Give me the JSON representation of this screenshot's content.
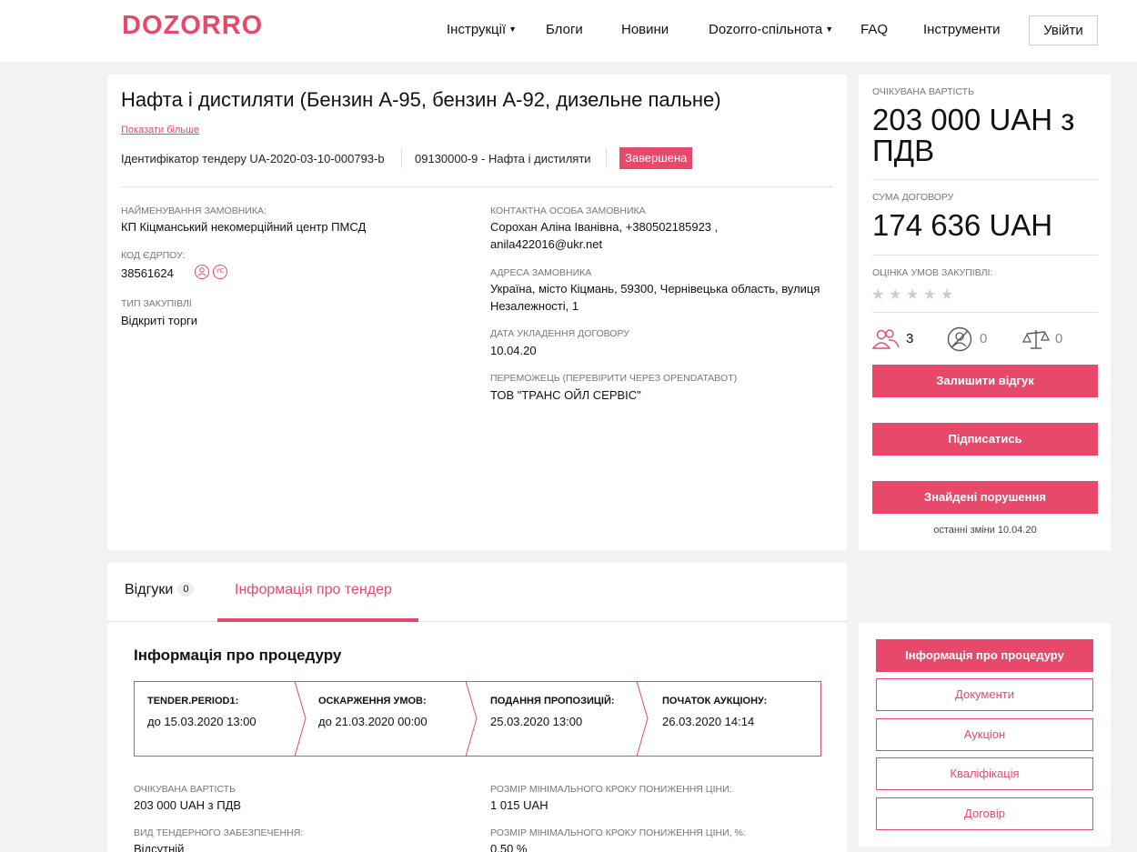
{
  "header": {
    "logo": "DOZORRO",
    "nav": [
      "Інструкції",
      "Блоги",
      "Новини",
      "Dozorro-спільнота",
      "FAQ",
      "Інструменти"
    ],
    "login": "Увійти"
  },
  "tender": {
    "title": "Нафта і дистиляти (Бензин А-95, бензин А-92, дизельне пальне)",
    "show_more": "Показати більше",
    "id_text": "Ідентифікатор тендеру UA-2020-03-10-000793-b",
    "cpv": "09130000-9 - Нафта і дистиляти",
    "status": "Завершена",
    "customer_label": "НАЙМЕНУВАННЯ ЗАМОВНИКА:",
    "customer": "КП Кіцманський некомерційний центр ПМСД",
    "edrpou_label": "КОД ЄДРПОУ:",
    "edrpou": "38561624",
    "edrpou_icon_2": "YC",
    "type_label": "ТИП ЗАКУПІВЛІ",
    "type": "Відкриті торги",
    "contact_label": "КОНТАКТНА ОСОБА ЗАМОВНИКА",
    "contact_line1": "Сорохан Аліна Іванівна, +380502185923 ,",
    "contact_line2": "anila422016@ukr.net",
    "address_label": "АДРЕСА ЗАМОВНИКА",
    "address_line1": "Україна, місто Кіцмань, 59300, Чернівецька область, вулиця",
    "address_line2": "Незалежності, 1",
    "date_label": "ДАТА УКЛАДЕННЯ ДОГОВОРУ",
    "date": "10.04.20",
    "winner_label": "ПЕРЕМОЖЕЦЬ (ПЕРЕВІРИТИ ЧЕРЕЗ OPENDATABOT)",
    "winner": "ТОВ \"ТРАНС ОЙЛ СЕРВІС\""
  },
  "side": {
    "expected_label": "ОЧІКУВАНА ВАРТІСТЬ",
    "expected_line1": "203 000 UAH з",
    "expected_line2": "ПДВ",
    "contract_label": "СУМА ДОГОВОРУ",
    "contract": "174 636 UAH",
    "rating_label": "ОЦІНКА УМОВ ЗАКУПІВЛІ:",
    "rating": 0,
    "stats": [
      "3",
      "0",
      "0"
    ],
    "btn_review": "Залишити відгук",
    "btn_subscribe": "Підписатись",
    "btn_violations": "Знайдені порушення",
    "last_change": "останні зміни 10.04.20",
    "accent": "#e8496a"
  },
  "tabs": {
    "reviews": "Відгуки",
    "reviews_count": "0",
    "info": "Інформація про тендер"
  },
  "procedure": {
    "title": "Інформація про процедуру",
    "steps": [
      {
        "label": "TENDER.PERIOD1:",
        "value": "до 15.03.2020 13:00"
      },
      {
        "label": "ОСКАРЖЕННЯ УМОВ:",
        "value": "до 21.03.2020 00:00"
      },
      {
        "label": "ПОДАННЯ ПРОПОЗИЦІЙ:",
        "value": "25.03.2020 13:00"
      },
      {
        "label": "ПОЧАТОК АУКЦІОНУ:",
        "value": "26.03.2020 14:14"
      }
    ],
    "expected_label": "ОЧІКУВАНА ВАРТІСТЬ",
    "expected": "203 000 UAH з ПДВ",
    "min_step_label": "РОЗМІР МІНІМАЛЬНОГО КРОКУ ПОНИЖЕННЯ ЦІНИ:",
    "min_step": "1 015 UAH",
    "security_label": "ВИД ТЕНДЕРНОГО ЗАБЕЗПЕЧЕННЯ:",
    "security": "Відсутній",
    "min_step_pct_label": "РОЗМІР МІНІМАЛЬНОГО КРОКУ ПОНИЖЕННЯ ЦІНИ, %:",
    "min_step_pct": "0.50 %"
  },
  "side_menu": [
    "Інформація про процедуру",
    "Документи",
    "Аукціон",
    "Кваліфікація",
    "Договір"
  ]
}
